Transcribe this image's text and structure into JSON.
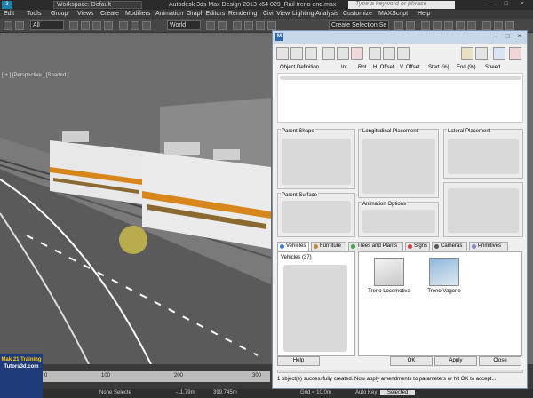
{
  "app": {
    "logo": "3",
    "workspace": "Workspace: Default",
    "title": "Autodesk 3ds Max Design 2013 x64    029_Rail treno end.max",
    "search_placeholder": "Type a keyword or phrase"
  },
  "menu": [
    "Edit",
    "Tools",
    "Group",
    "Views",
    "Create",
    "Modifiers",
    "Animation",
    "Graph Editors",
    "Rendering",
    "Civil View",
    "Lighting Analysis",
    "Customize",
    "MAXScript",
    "Help"
  ],
  "toolbar": {
    "filter": "All",
    "coord": "World",
    "selection_set": "Create Selection Se"
  },
  "viewport": {
    "label": "[ + ] [Perspective ] [Shaded ]"
  },
  "timeline": {
    "ticks": [
      "0",
      "100",
      "200",
      "300"
    ]
  },
  "bottom": {
    "none_selected": "None Selecte",
    "x": "-11.79m",
    "y": "399.745m",
    "grid": "Grid = 10.0m",
    "autokey": "Auto Key",
    "selected": "Selected"
  },
  "watermark": {
    "line1": "Mak 21 Training",
    "line2": "Tutors3d.com"
  },
  "dialog": {
    "columns": [
      "Object Definition",
      "Int.",
      "Rot.",
      "H. Offset",
      "V. Offset",
      "Start (%)",
      "End (%)",
      "Speed"
    ],
    "groups": {
      "parent_shape": "Parent Shape",
      "longitudinal": "Longitudinal Placement",
      "lateral": "Lateral Placement",
      "parent_surface": "Parent Surface",
      "animation": "Animation Options"
    },
    "tabs": [
      {
        "label": "Vehicles",
        "color": "#3a7bd5"
      },
      {
        "label": "Furniture",
        "color": "#c08a3a"
      },
      {
        "label": "Trees and Plants",
        "color": "#3aa04a"
      },
      {
        "label": "Signs",
        "color": "#d04040"
      },
      {
        "label": "Cameras",
        "color": "#555555"
      },
      {
        "label": "Primitives",
        "color": "#8888cc"
      }
    ],
    "category": "Vehicles (37)",
    "items": [
      {
        "label": "Treno Locomotiva"
      },
      {
        "label": "Treno Vagone"
      }
    ],
    "buttons": {
      "help": "Help",
      "ok": "OK",
      "apply": "Apply",
      "close": "Close"
    },
    "status": "1 object(s) successfully created. Now apply amendments to parameters or hit OK to accept..."
  }
}
